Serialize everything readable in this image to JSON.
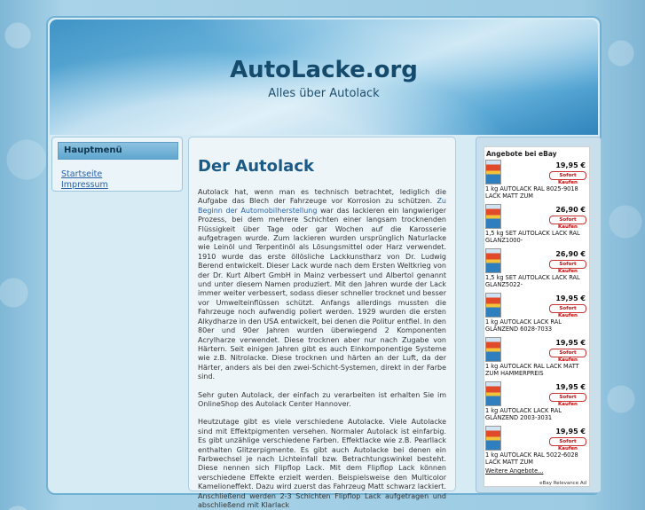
{
  "header": {
    "title": "AutoLacke.org",
    "subtitle": "Alles über Autolack"
  },
  "sidebar": {
    "heading": "Hauptmenü",
    "links": [
      {
        "label": "Startseite"
      },
      {
        "label": "Impressum"
      }
    ]
  },
  "main": {
    "heading": "Der Autolack",
    "p1_before_link": "Autolack hat, wenn man es technisch betrachtet, lediglich die Aufgabe das Blech der Fahrzeuge vor Korrosion zu schützen. ",
    "p1_link": "Zu Beginn der Automobilherstellung",
    "p1_after_link": " war das lackieren ein langwieriger Prozess, bei dem mehrere Schichten einer langsam trocknenden Flüssigkeit über Tage oder gar Wochen auf die Karosserie aufgetragen wurde. Zum lackieren wurden ursprünglich Naturlacke wie Leinöl und Terpentinöl als Lösungsmittel oder Harz verwendet. 1910 wurde das erste öllösliche Lackkunstharz von Dr. Ludwig Berend entwickelt. Dieser Lack wurde nach dem Ersten Weltkrieg von der Dr. Kurt Albert GmbH in Mainz verbessert und Albertol genannt und unter diesem Namen produziert. Mit den Jahren wurde der Lack immer weiter verbessert, sodass dieser schneller trocknet und besser vor Umwelteinflüssen schützt. Anfangs allerdings mussten die Fahrzeuge noch aufwendig poliert werden. 1929 wurden die ersten Alkydharze in den USA entwickelt, bei denen die Politur entfiel. In den 80er und 90er Jahren wurden überwiegend 2 Komponenten Acrylharze verwendet. Diese trocknen aber nur nach Zugabe von Härtern. Seit einigen Jahren gibt es auch Einkomponentige Systeme wie z.B. Nitrolacke. Diese trocknen und härten an der Luft, da der Härter, anders als bei den zwei-Schicht-Systemen, direkt in der Farbe sind.",
    "p2": "Sehr guten Autolack, der einfach zu verarbeiten ist erhalten Sie im OnlineShop des Autolack Center Hannover.",
    "p3": "Heutzutage gibt es viele verschiedene Autolacke. Viele Autolacke sind mit Effektpigmenten versehen. Normaler Autolack ist einfarbig. Es gibt unzählige verschiedene Farben. Effektlacke wie z.B. Pearllack enthalten Glitzerpigmente. Es gibt auch Autolacke bei denen ein Farbwechsel je nach Lichteinfall bzw. Betrachtungswinkel besteht. Diese nennen sich Flipflop Lack. Mit dem Flipflop Lack können verschiedene Effekte erzielt werden. Beispielsweise den Multicolor Kamelioneffekt. Dazu wird zuerst das Fahrzeug Matt schwarz lackiert. Anschließend werden 2-3 Schichten Flipflop Lack aufgetragen und abschließend mit Klarlack"
  },
  "ebay": {
    "title": "Angebote bei eBay",
    "buy_label": "Sofort Kaufen",
    "items": [
      {
        "price": "19,95 €",
        "title": "1 kg AUTOLACK RAL 8025-9018 LACK MATT ZUM"
      },
      {
        "price": "26,90 €",
        "title": "1,5 kg SET AUTOLACK LACK RAL GLANZ1000-"
      },
      {
        "price": "26,90 €",
        "title": "1,5 kg SET AUTOLACK LACK RAL GLANZ5022-"
      },
      {
        "price": "19,95 €",
        "title": "1 kg AUTOLACK LACK RAL GLÄNZEND 6028-7033"
      },
      {
        "price": "19,95 €",
        "title": "1 kg AUTOLACK RAL LACK MATT ZUM HAMMERPREIS"
      },
      {
        "price": "19,95 €",
        "title": "1 kg AUTOLACK LACK RAL GLÄNZEND 2003-3031"
      },
      {
        "price": "19,95 €",
        "title": "1 kg AUTOLACK RAL 5022-6028 LACK MATT ZUM"
      }
    ],
    "more": "Weitere Angebote...",
    "relevance": "eBay Relevance Ad"
  }
}
